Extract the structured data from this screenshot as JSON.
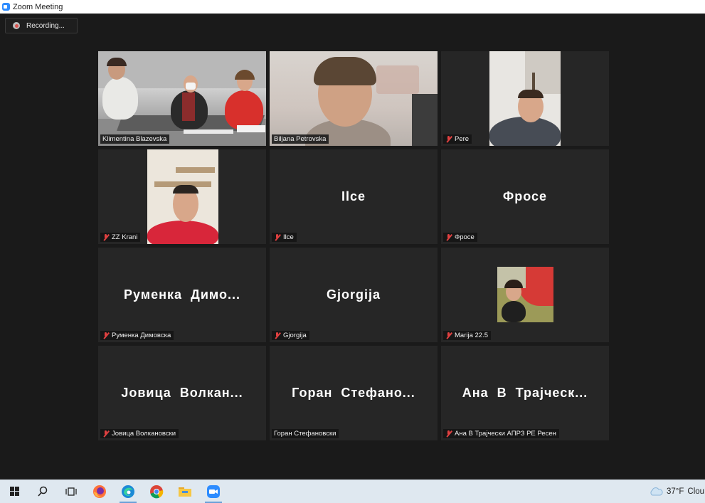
{
  "window": {
    "title": "Zoom Meeting"
  },
  "recording": {
    "label": "Recording..."
  },
  "participants": [
    {
      "tag": "Klimentina Blazevska",
      "muted": false,
      "video": true
    },
    {
      "tag": "Biljana Petrovska",
      "muted": false,
      "video": true
    },
    {
      "tag": "Pere",
      "muted": true,
      "video": true
    },
    {
      "tag": "ZZ Krani",
      "muted": true,
      "video": true
    },
    {
      "tag": "Ilce",
      "display": "Ilce",
      "muted": true,
      "video": false
    },
    {
      "tag": "Фросе",
      "display": "Фросе",
      "muted": true,
      "video": false
    },
    {
      "tag": "Руменка Димовска",
      "display": "Руменка  Димо...",
      "muted": true,
      "video": false
    },
    {
      "tag": "Gjorgija",
      "display": "Gjorgija",
      "muted": true,
      "video": false
    },
    {
      "tag": "Marija 22.5",
      "muted": true,
      "video": false,
      "photo": true
    },
    {
      "tag": "Јовица Волкановски",
      "display": "Јовица  Волкан...",
      "muted": true,
      "video": false
    },
    {
      "tag": "Горан Стефановски",
      "display": "Горан  Стефано...",
      "muted": false,
      "video": false
    },
    {
      "tag": "Ана В Трајчески АПРЗ РЕ Ресен",
      "display": "Ана  В  Трајческ...",
      "muted": true,
      "video": false
    }
  ],
  "taskbar": {
    "items": [
      "windows-start",
      "search",
      "task-view",
      "firefox",
      "edge",
      "chrome",
      "file-explorer",
      "zoom"
    ],
    "active": "edge",
    "weather": {
      "temp": "37°F",
      "condition": "Clou"
    }
  },
  "colors": {
    "active_speaker": "#c6e05a",
    "muted_mic": "#e04040",
    "zoom_blue": "#2d8cff"
  }
}
